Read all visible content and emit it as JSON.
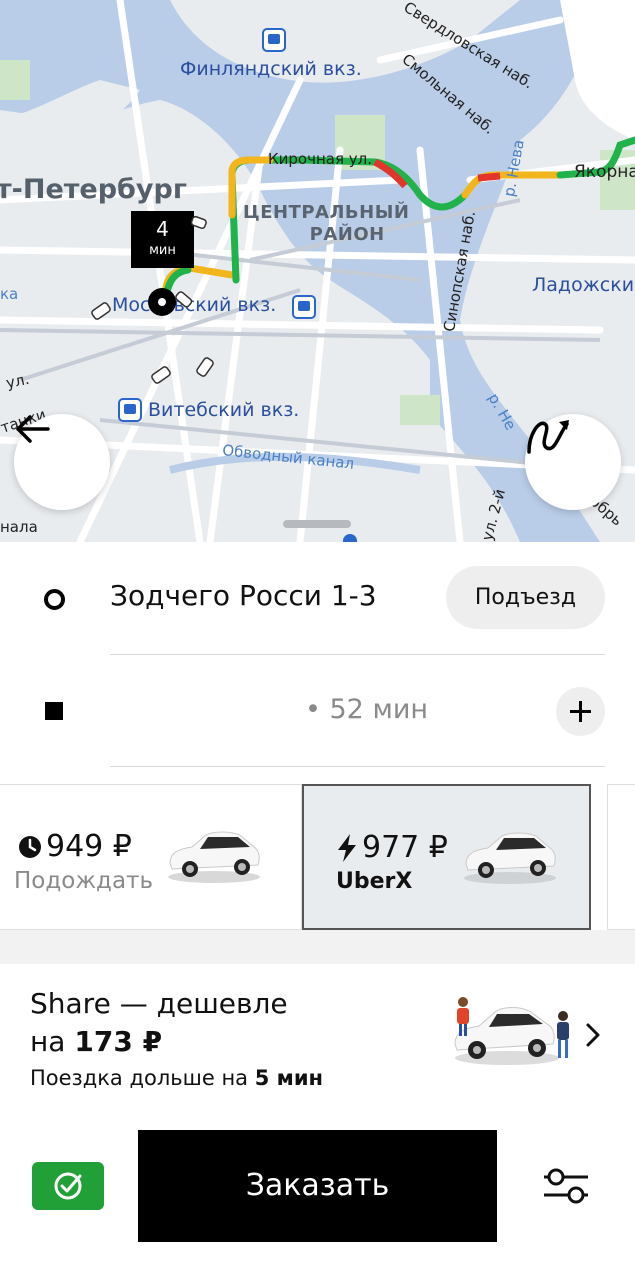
{
  "map": {
    "labels": {
      "city": "т-Петербург",
      "district_line1": "ЦЕНТРАЛЬНЫЙ",
      "district_line2": "РАЙОН",
      "station_finland": "Финляндский вкз.",
      "station_moscow": "Московский вкз.",
      "station_vitebsk": "Витебский вкз.",
      "street_kirochnaya": "Кирочная ул.",
      "street_smolnaya": "Смольная наб.",
      "street_sverdlovskaya": "Свердловская наб.",
      "street_sinopskaya": "Синопская наб.",
      "street_yakornaya": "Якорна",
      "street_ladozhskiy": "Ладожски",
      "river_neva": "р. Нева",
      "river_neva2": "р. Не",
      "canal_obvodny": "Обводный канал",
      "street_ul": "ул.",
      "street_ul2": "ул. 2-й",
      "street_tanki": "танки",
      "street_nala": "нала",
      "street_dobr": "обрь",
      "river_ka": "ка"
    },
    "eta_badge": {
      "value": "4",
      "unit": "мин"
    },
    "colors": {
      "water": "#b9cde8",
      "park": "#cfe5c7",
      "road": "#ffffff",
      "route_green": "#21b24b",
      "route_yellow": "#f2b51b",
      "route_red": "#e2352b"
    }
  },
  "pickup": {
    "address": "Зодчего Росси 1-3",
    "entrance_label": "Подъезд"
  },
  "destination": {
    "eta": "• 52 мин"
  },
  "ride_options": [
    {
      "price": "949 ₽",
      "name": "Подождать",
      "icon": "clock-icon",
      "selected": false
    },
    {
      "price": "977 ₽",
      "name": "UberX",
      "icon": "lightning-icon",
      "selected": true
    }
  ],
  "share_promo": {
    "line1": "Share — дешевле",
    "line2_prefix": "на ",
    "line2_amount": "173 ₽",
    "line3_prefix": "Поездка дольше на ",
    "line3_amount": "5 мин"
  },
  "actions": {
    "order_label": "Заказать",
    "payment_icon": "sber-check-icon",
    "preferences_icon": "sliders-icon",
    "payment_color": "#21a038"
  }
}
